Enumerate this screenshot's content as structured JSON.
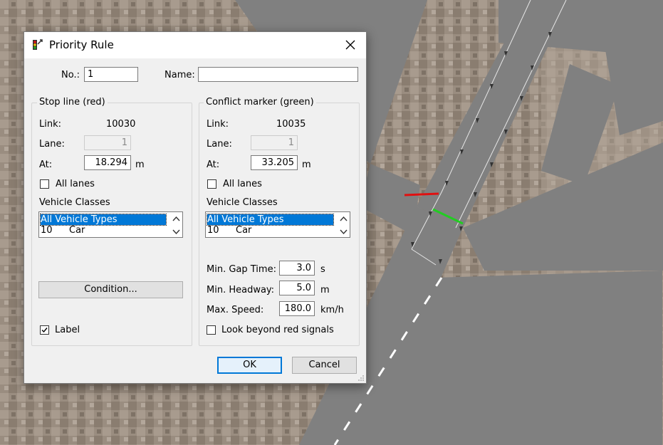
{
  "window": {
    "title": "Priority Rule",
    "close_glyph": "×"
  },
  "header": {
    "no_label": "No.:",
    "no_value": "1",
    "name_label": "Name:",
    "name_value": ""
  },
  "stop_line": {
    "group_title": "Stop line (red)",
    "link_label": "Link:",
    "link_value": "10030",
    "lane_label": "Lane:",
    "lane_value": "1",
    "at_label": "At:",
    "at_value": "18.294",
    "at_unit": "m",
    "all_lanes_label": "All lanes",
    "all_lanes_checked": false,
    "vehicle_classes_label": "Vehicle Classes",
    "vehicle_classes": [
      {
        "code": "All Vehicle Types",
        "name": "",
        "selected": true
      },
      {
        "code": "10",
        "name": "Car",
        "selected": false
      }
    ],
    "condition_button": "Condition...",
    "label_checkbox": "Label",
    "label_checked": true
  },
  "conflict_marker": {
    "group_title": "Conflict marker (green)",
    "link_label": "Link:",
    "link_value": "10035",
    "lane_label": "Lane:",
    "lane_value": "1",
    "at_label": "At:",
    "at_value": "33.205",
    "at_unit": "m",
    "all_lanes_label": "All lanes",
    "all_lanes_checked": false,
    "vehicle_classes_label": "Vehicle Classes",
    "vehicle_classes": [
      {
        "code": "All Vehicle Types",
        "name": "",
        "selected": true
      },
      {
        "code": "10",
        "name": "Car",
        "selected": false
      }
    ],
    "min_gap_time_label": "Min. Gap Time:",
    "min_gap_time_value": "3.0",
    "min_gap_time_unit": "s",
    "min_headway_label": "Min. Headway:",
    "min_headway_value": "5.0",
    "min_headway_unit": "m",
    "max_speed_label": "Max. Speed:",
    "max_speed_value": "180.0",
    "max_speed_unit": "km/h",
    "look_beyond_label": "Look beyond red signals",
    "look_beyond_checked": false
  },
  "footer": {
    "ok_label": "OK",
    "cancel_label": "Cancel"
  },
  "colors": {
    "stop_line": "#e01010",
    "conflict_marker": "#22cc22",
    "road": "#808080",
    "selection": "#0078d7"
  },
  "icons": {
    "title": "traffic-signal-icon",
    "close": "close-icon"
  }
}
